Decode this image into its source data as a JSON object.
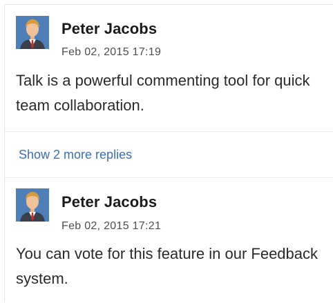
{
  "comments": [
    {
      "author": "Peter Jacobs",
      "timestamp": "Feb 02, 2015 17:19",
      "text": "Talk is a powerful commenting tool for quick team collaboration.",
      "avatar_icon": "user-avatar-icon"
    },
    {
      "author": "Peter Jacobs",
      "timestamp": "Feb 02, 2015 17:21",
      "text": "You can vote for this feature in our Feedback system.",
      "avatar_icon": "user-avatar-icon"
    }
  ],
  "show_more_replies": "Show 2 more replies",
  "colors": {
    "link": "#3a6fb5",
    "avatar_bg": "#4f7fb8",
    "divider": "#ededed"
  }
}
